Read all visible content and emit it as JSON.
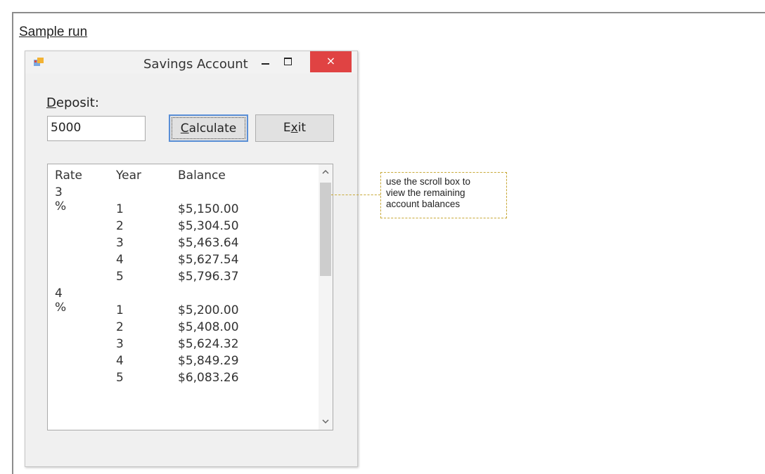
{
  "caption": "Sample run",
  "window": {
    "title": "Savings Account",
    "close_glyph": "×",
    "icons": [
      "app-icon",
      "minimize-icon",
      "maximize-icon",
      "close-icon"
    ]
  },
  "form": {
    "deposit_label_access": "D",
    "deposit_label_rest": "eposit:",
    "deposit_value": "5000",
    "calculate_access": "C",
    "calculate_rest": "alculate",
    "exit_before": "E",
    "exit_access": "x",
    "exit_after": "it"
  },
  "list": {
    "headers": {
      "rate": "Rate",
      "year": "Year",
      "balance": "Balance"
    },
    "rows": [
      {
        "rate": "3 %",
        "year": "",
        "balance": ""
      },
      {
        "rate": "",
        "year": "1",
        "balance": "$5,150.00"
      },
      {
        "rate": "",
        "year": "2",
        "balance": "$5,304.50"
      },
      {
        "rate": "",
        "year": "3",
        "balance": "$5,463.64"
      },
      {
        "rate": "",
        "year": "4",
        "balance": "$5,627.54"
      },
      {
        "rate": "",
        "year": "5",
        "balance": "$5,796.37"
      },
      {
        "rate": "4 %",
        "year": "",
        "balance": ""
      },
      {
        "rate": "",
        "year": "1",
        "balance": "$5,200.00"
      },
      {
        "rate": "",
        "year": "2",
        "balance": "$5,408.00"
      },
      {
        "rate": "",
        "year": "3",
        "balance": "$5,624.32"
      },
      {
        "rate": "",
        "year": "4",
        "balance": "$5,849.29"
      },
      {
        "rate": "",
        "year": "5",
        "balance": "$6,083.26"
      }
    ]
  },
  "callout": {
    "lines": [
      "use the scroll box to",
      "view the remaining",
      "account balances"
    ]
  },
  "colors": {
    "close_button": "#e04343",
    "callout_border": "#c8a836",
    "focus_border": "#5a8fd6"
  }
}
